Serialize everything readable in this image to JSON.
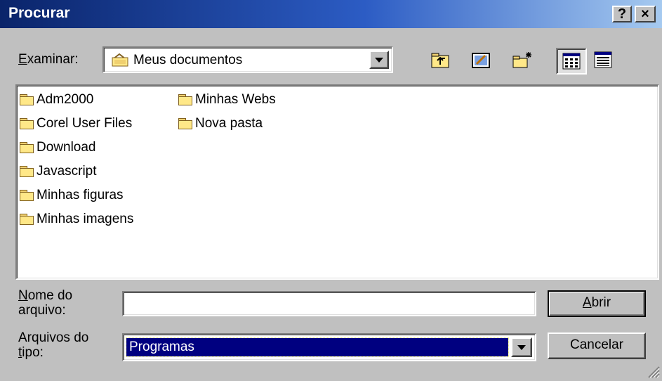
{
  "window": {
    "title": "Procurar"
  },
  "lookin": {
    "label_underlined": "E",
    "label_rest": "xaminar:",
    "value": "Meus documentos"
  },
  "files": [
    {
      "name": "Adm2000"
    },
    {
      "name": "Corel User Files"
    },
    {
      "name": "Download"
    },
    {
      "name": "Javascript"
    },
    {
      "name": "Minhas figuras"
    },
    {
      "name": "Minhas imagens"
    },
    {
      "name": "Minhas Webs"
    },
    {
      "name": "Nova pasta"
    }
  ],
  "filename": {
    "label_u": "N",
    "label_line1_rest": "ome do",
    "label_line2": "arquivo:",
    "value": ""
  },
  "filetype": {
    "label_line1": "Arquivos do",
    "label_u": "t",
    "label_line2_rest": "ipo:",
    "value": "Programas"
  },
  "buttons": {
    "open_u": "A",
    "open_rest": "brir",
    "cancel": "Cancelar",
    "help": "?",
    "close": "×"
  },
  "icons": [
    "help-icon",
    "close-icon",
    "folder-icon",
    "up-one-level-icon",
    "desktop-icon",
    "new-folder-icon",
    "list-view-icon",
    "details-view-icon",
    "dropdown-arrow-icon",
    "size-grip-icon"
  ],
  "colors": {
    "title_start": "#0a246a",
    "title_end": "#a6caf0",
    "selection": "#000080",
    "face": "#c0c0c0"
  }
}
